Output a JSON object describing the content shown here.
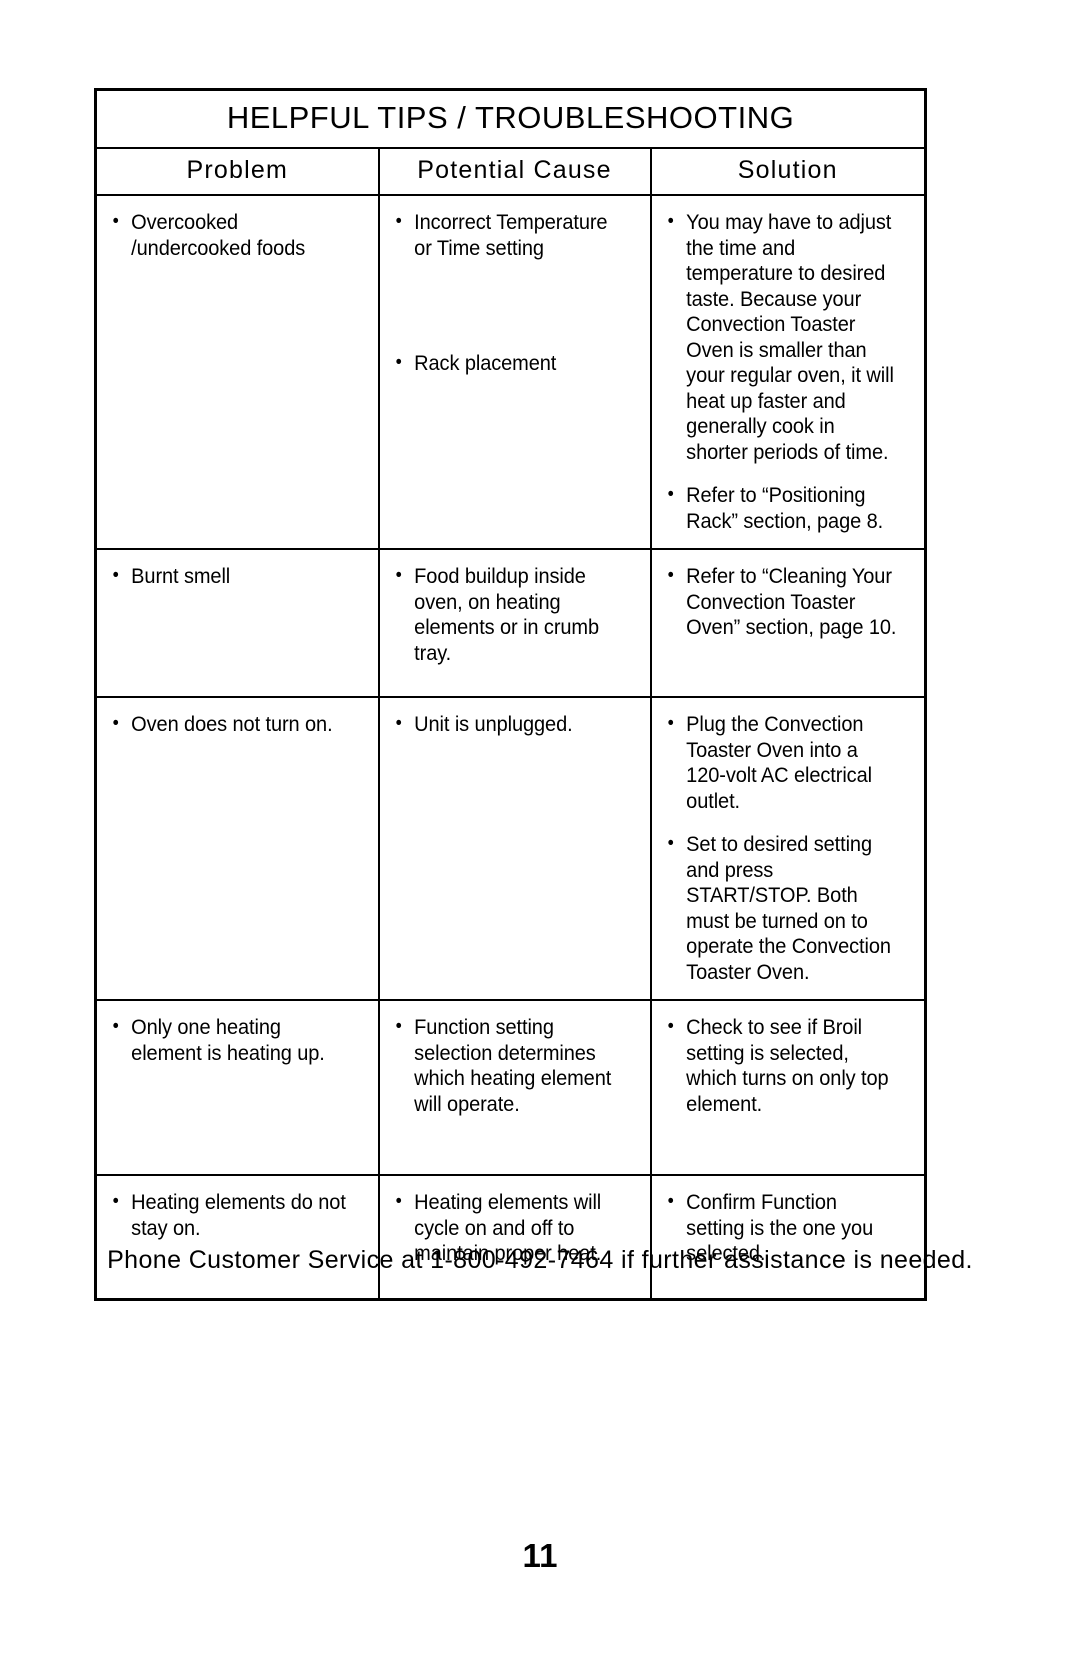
{
  "document": {
    "title": "HELPFUL TIPS / TROUBLESHOOTING",
    "page_number": "11",
    "footer_note": "Phone Customer Service at 1-800-492-7464 if further assistance is needed."
  },
  "table": {
    "columns": {
      "problem": "Problem",
      "cause": "Potential Cause",
      "solution": "Solution"
    },
    "rows": [
      {
        "problem": [
          "Overcooked /undercooked foods"
        ],
        "cause": [
          "Incorrect Temperature or Time setting",
          "Rack placement"
        ],
        "solution": [
          "You may have to adjust the time and temperature to desired taste. Because your Convection Toaster Oven is smaller than your regular oven, it will heat up faster and generally cook in shorter periods of time.",
          "Refer to “Positioning Rack” section, page 8."
        ]
      },
      {
        "problem": [
          "Burnt smell"
        ],
        "cause": [
          "Food buildup inside oven, on heating elements or in crumb tray."
        ],
        "solution": [
          "Refer to “Cleaning Your Convection Toaster Oven” section, page 10."
        ]
      },
      {
        "problem": [
          "Oven does not turn on."
        ],
        "cause": [
          "Unit is unplugged."
        ],
        "solution": [
          "Plug the Convection Toaster Oven into a 120-volt AC electrical outlet.",
          "Set to desired setting and press START/STOP. Both must be turned on to operate the Convection Toaster Oven."
        ]
      },
      {
        "problem": [
          "Only one heating element is heating up."
        ],
        "cause": [
          "Function setting selection determines which heating element will operate."
        ],
        "solution": [
          "Check to see if Broil setting is selected, which turns on only top element."
        ]
      },
      {
        "problem": [
          "Heating elements do not stay on."
        ],
        "cause": [
          "Heating elements will cycle on and off to maintain proper heat."
        ],
        "solution": [
          "Confirm Function setting is the one you selected."
        ]
      }
    ]
  }
}
